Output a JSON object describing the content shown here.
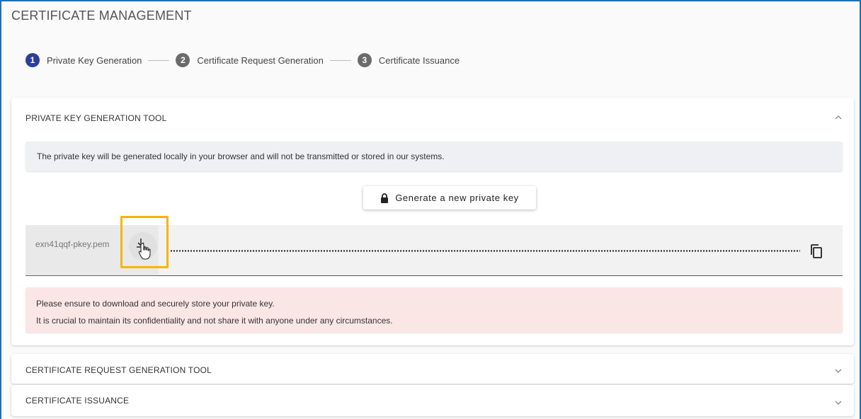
{
  "page": {
    "title": "CERTIFICATE MANAGEMENT"
  },
  "stepper": {
    "steps": [
      {
        "number": "1",
        "label": "Private Key Generation"
      },
      {
        "number": "2",
        "label": "Certificate Request Generation"
      },
      {
        "number": "3",
        "label": "Certificate Issuance"
      }
    ]
  },
  "panels": {
    "private_key": {
      "title": "PRIVATE KEY GENERATION TOOL",
      "info": "The private key will be generated locally in your browser and will not be transmitted or stored in our systems.",
      "generate_button": "Generate a new private key",
      "filename": "exn41qqf-pkey.pem",
      "warning_line1": "Please ensure to download and securely store your private key.",
      "warning_line2": "It is crucial to maintain its confidentiality and not share it with anyone under any circumstances."
    },
    "csr": {
      "title": "CERTIFICATE REQUEST GENERATION TOOL"
    },
    "issuance": {
      "title": "CERTIFICATE ISSUANCE"
    }
  },
  "icons": {
    "lock": "lock-icon",
    "download": "download-icon",
    "pointer": "hand-pointer-icon",
    "copy": "copy-icon",
    "collapse": "chevron-up-icon",
    "expand": "chevron-down-icon"
  },
  "colors": {
    "frame_border": "#1f6fb5",
    "active_step": "#2c3e9c",
    "inactive_step": "#6b6b6b",
    "highlight": "#f7b500",
    "warning_bg": "#fbe6e6",
    "info_bg": "#eef0f3"
  }
}
